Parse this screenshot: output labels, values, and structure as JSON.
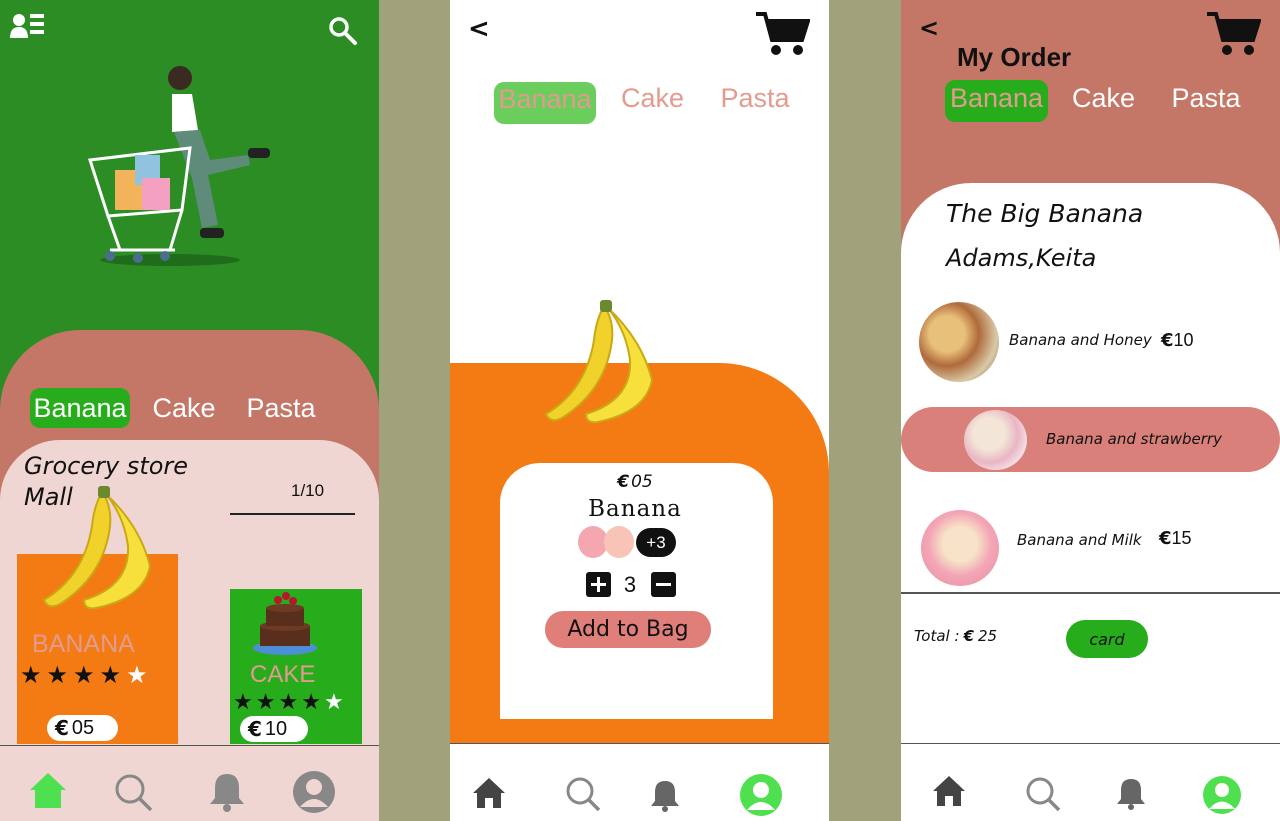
{
  "colors": {
    "green": "#2c8d25",
    "tab_green": "#27ad1c",
    "salmon": "#c47767",
    "pink": "#f0d6d2",
    "orange": "#f47a14",
    "rose": "#d9807a",
    "separator": "#9fa27b"
  },
  "screen1": {
    "tabs": [
      "Banana",
      "Cake",
      "Pasta"
    ],
    "store_title": "Grocery store\nMall",
    "pagination": "1/10",
    "products": [
      {
        "name": "BANANA",
        "rating": 4,
        "max_rating": 5,
        "price_symbol": "€",
        "price": "05"
      },
      {
        "name": "CAKE",
        "rating": 4,
        "max_rating": 5,
        "price_symbol": "€",
        "price": "10"
      }
    ],
    "nav": [
      "home-icon",
      "search-icon",
      "bell-icon",
      "profile-icon"
    ]
  },
  "screen2": {
    "back": "<",
    "tabs": [
      "Banana",
      "Cake",
      "Pasta"
    ],
    "price_symbol": "€",
    "price": "05",
    "product_name": "Banana",
    "extra_count": "+3",
    "quantity": "3",
    "add_button": "Add to Bag",
    "nav": [
      "home-icon",
      "search-icon",
      "bell-icon",
      "profile-icon"
    ]
  },
  "screen3": {
    "back": "<",
    "title": "My Order",
    "tabs": [
      "Banana",
      "Cake",
      "Pasta"
    ],
    "shop_name": "The Big Banana",
    "customer": "Adams,Keita",
    "items": [
      {
        "name": "Banana and Honey",
        "price_symbol": "€",
        "price": "10"
      },
      {
        "name": "Banana and strawberry",
        "price_symbol": "",
        "price": ""
      },
      {
        "name": "Banana and Milk",
        "price_symbol": "€",
        "price": "15"
      }
    ],
    "total_label": "Total :",
    "total_symbol": "€",
    "total": "25",
    "pay_button": "card",
    "nav": [
      "home-icon",
      "search-icon",
      "bell-icon",
      "profile-icon"
    ]
  }
}
